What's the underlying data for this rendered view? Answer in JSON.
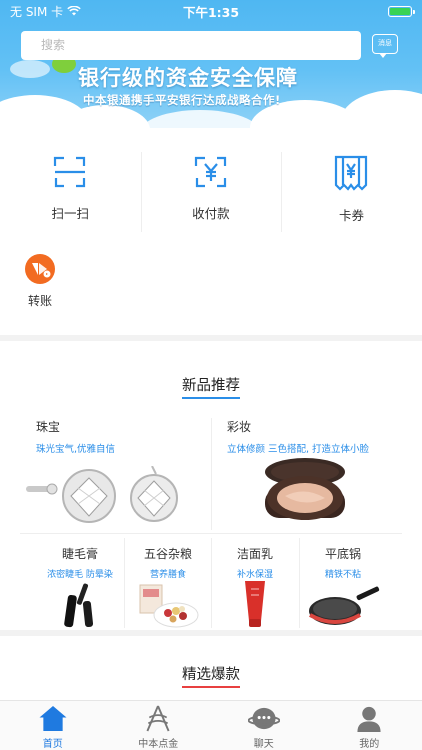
{
  "status_bar": {
    "carrier": "无 SIM 卡",
    "time": "下午1:35"
  },
  "search": {
    "placeholder": "搜索"
  },
  "message_button": {
    "label": "消息"
  },
  "banner": {
    "title": "银行级的资金安全保障",
    "subtitle": "中本银通携手平安银行达成战略合作!"
  },
  "quick_actions": [
    {
      "label": "扫一扫",
      "icon": "scan-icon"
    },
    {
      "label": "收付款",
      "icon": "yuan-scan-icon"
    },
    {
      "label": "卡券",
      "icon": "coupon-icon"
    }
  ],
  "transfer": {
    "label": "转账",
    "icon": "transfer-icon"
  },
  "new_products": {
    "title": "新品推荐",
    "big": [
      {
        "name": "珠宝",
        "desc": "珠光宝气,优雅自信"
      },
      {
        "name": "彩妆",
        "desc": "立体修颜 三色搭配, 打造立体小脸"
      }
    ],
    "small": [
      {
        "name": "睫毛膏",
        "desc": "浓密睫毛 防晕染"
      },
      {
        "name": "五谷杂粮",
        "desc": "营养膳食"
      },
      {
        "name": "洁面乳",
        "desc": "补水保湿"
      },
      {
        "name": "平底锅",
        "desc": "精铁不粘"
      }
    ]
  },
  "featured": {
    "title": "精选爆款"
  },
  "tabbar": [
    {
      "label": "首页",
      "icon": "home-icon",
      "active": true
    },
    {
      "label": "中本点金",
      "icon": "gold-icon",
      "active": false
    },
    {
      "label": "聊天",
      "icon": "chat-icon",
      "active": false
    },
    {
      "label": "我的",
      "icon": "profile-icon",
      "active": false
    }
  ],
  "colors": {
    "accent_blue": "#2a8ee8",
    "banner_blue": "#4fb7f2",
    "transfer_orange": "#f26b21",
    "active_tab": "#1f7ae0"
  }
}
